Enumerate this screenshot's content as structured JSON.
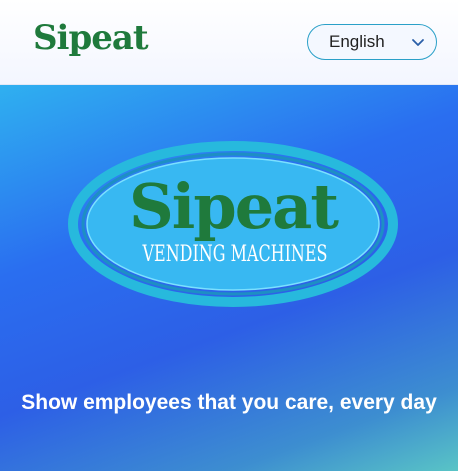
{
  "header": {
    "brand": "Sipeat",
    "language_selector": {
      "selected": "English"
    }
  },
  "hero": {
    "logo": {
      "title": "Sipeat",
      "subtitle": "VENDING MACHINES"
    },
    "tagline": "Show employees that you care, every day"
  },
  "colors": {
    "brand_green": "#1f7a3c",
    "selector_border": "#2aa0c8",
    "hero_blue": "#2a6ef0",
    "logo_ring": "#26b6d8"
  },
  "icons": {
    "language_chevron": "chevron-down-icon"
  }
}
